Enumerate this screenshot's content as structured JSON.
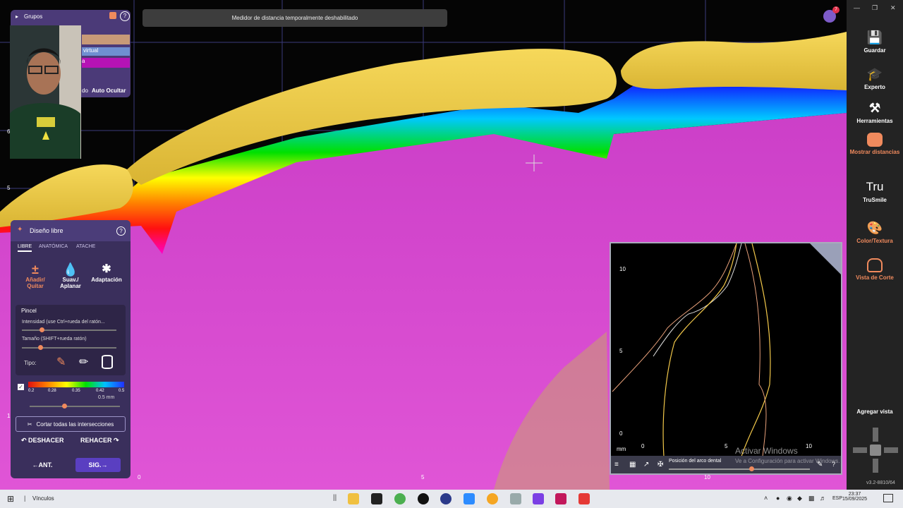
{
  "viewport": {
    "notice": "Medidor de distancia temporalmente deshabilitado",
    "notification_count": "7",
    "axis_labels_left": [
      "6",
      "5",
      "4",
      "3",
      "2",
      "1",
      "0"
    ],
    "axis_labels_bottom": [
      "0",
      "5",
      "10"
    ]
  },
  "groups_panel": {
    "title": "Grupos",
    "row_virtual": "virtual",
    "row_truncated_a": "a",
    "row_truncated_do": "do",
    "auto_hide": "Auto Ocultar"
  },
  "design_panel": {
    "title": "Diseño libre",
    "tabs": [
      "LIBRE",
      "ANATÓMICA",
      "ATACHE"
    ],
    "tools": [
      {
        "label": "Añadir/\nQuitar",
        "icon": "add-remove-icon"
      },
      {
        "label": "Suav./\nAplanar",
        "icon": "drop-icon"
      },
      {
        "label": "Adaptación",
        "icon": "adaptation-icon"
      }
    ],
    "brush_section": "Pincel",
    "intensity_label": "Intensidad (use Ctrl+rueda del ratón...",
    "size_label": "Tamaño (SHIFT+rueda ratón)",
    "type_label": "Tipo:",
    "color_scale": [
      "0.2",
      "0.28",
      "0.35",
      "0.42",
      "0.5"
    ],
    "thickness_value": "0.5 mm",
    "cut_all": "Cortar todas las intersecciones",
    "undo": "DESHACER",
    "redo": "REHACER",
    "prev": "ANT.",
    "next": "SIG."
  },
  "section_view": {
    "y_ticks": [
      "10",
      "5",
      "0"
    ],
    "x_ticks": [
      "0",
      "5",
      "10"
    ],
    "unit": "mm",
    "position_label": "Posición del arco dental",
    "watermark_title": "Activar Windows",
    "watermark_sub": "Ve a Configuración para activar Windows."
  },
  "sidebar": {
    "items": [
      {
        "label": "Guardar",
        "icon": "save-icon"
      },
      {
        "label": "Experto",
        "icon": "graduation-cap-icon"
      },
      {
        "label": "Herramientas",
        "icon": "tools-icon"
      },
      {
        "label": "Mostrar distancias",
        "icon": "tooth-distance-icon"
      },
      {
        "label": "TruSmile",
        "icon": "trusmile-icon"
      },
      {
        "label": "Color/Textura",
        "icon": "palette-icon"
      },
      {
        "label": "Vista de Corte",
        "icon": "cross-section-icon"
      }
    ],
    "add_view": "Agregar vista",
    "version": "v3.2-8810/64"
  },
  "taskbar": {
    "search_label": "Vínculos",
    "language": "ESP",
    "time": "23:37",
    "date": "15/09/2025"
  },
  "colors": {
    "accent": "#5a3fc1",
    "panel": "#3a2f5c",
    "tooth": "#e8c445",
    "gum": "#d94fd0",
    "highlight": "#f08a5d"
  }
}
